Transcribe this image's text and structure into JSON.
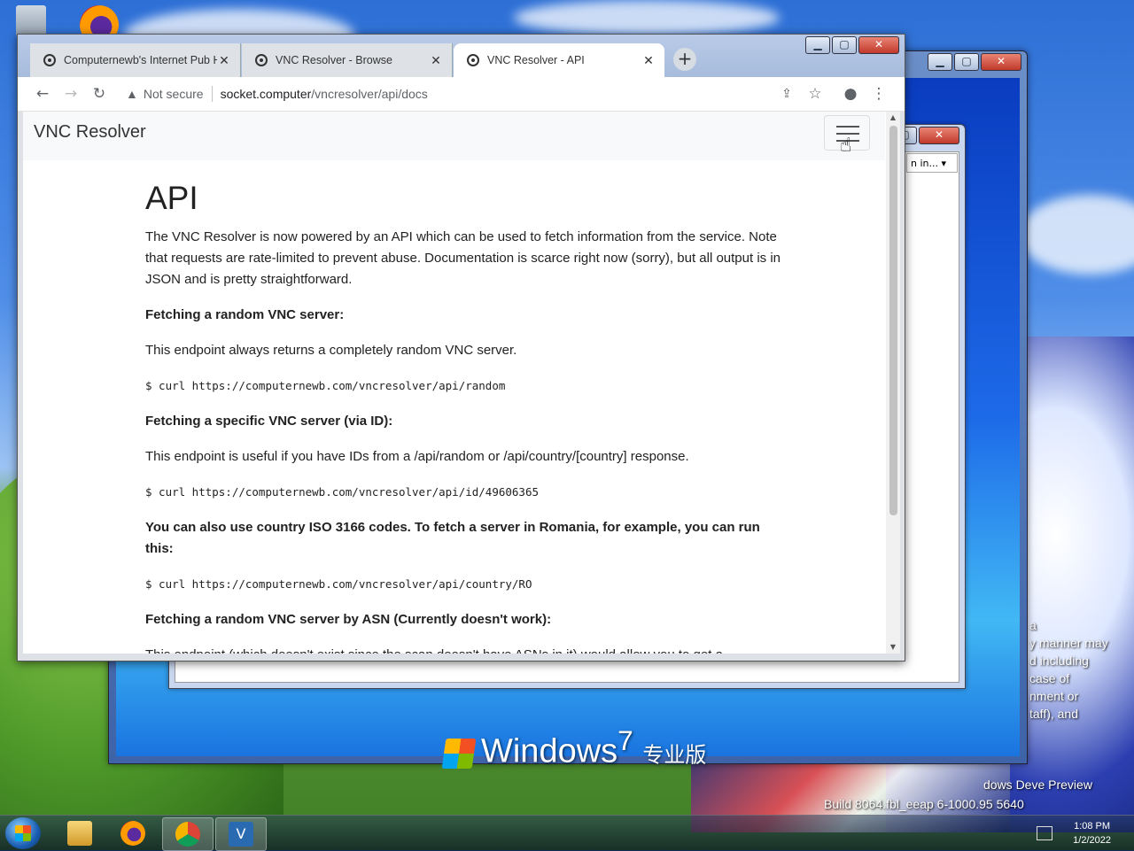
{
  "desktop": {
    "watermark_text": "Windows",
    "watermark_seven": "7",
    "watermark_edition": "专业版",
    "side_text": [
      "a",
      "y manner may",
      "d including",
      "case of",
      "nment or",
      "taff), and"
    ],
    "build_line1": "dows Deve      Preview",
    "build_line2": "Build 8064.fbl_eeap     6-1000.95      5640"
  },
  "dialog": {
    "dropdown_value": "n in..."
  },
  "browser": {
    "tabs": [
      {
        "title": "Computernewb's Internet Pub H",
        "active": false
      },
      {
        "title": "VNC Resolver - Browse",
        "active": false
      },
      {
        "title": "VNC Resolver - API",
        "active": true
      }
    ],
    "new_tab": "+",
    "address": {
      "security_label": "Not secure",
      "host": "socket.computer",
      "path": "/vncresolver/api/docs"
    },
    "caption_buttons": {
      "minimize": "▁",
      "maximize": "▢",
      "close": "✕"
    }
  },
  "page": {
    "brand": "VNC Resolver",
    "heading": "API",
    "intro": "The VNC Resolver is now powered by an API which can be used to fetch information from the service. Note that requests are rate-limited to prevent abuse. Documentation is scarce right now (sorry), but all output is in JSON and is pretty straightforward.",
    "sections": [
      {
        "title": "Fetching a random VNC server:",
        "desc": "This endpoint always returns a completely random VNC server.",
        "code": "$ curl https://computernewb.com/vncresolver/api/random"
      },
      {
        "title": "Fetching a specific VNC server (via ID):",
        "desc": "This endpoint is useful if you have IDs from a /api/random or /api/country/[country] response.",
        "code": "$ curl https://computernewb.com/vncresolver/api/id/49606365"
      },
      {
        "title": "You can also use country ISO 3166 codes. To fetch a server in Romania, for example, you can run this:",
        "code": "$ curl https://computernewb.com/vncresolver/api/country/RO"
      },
      {
        "title": "Fetching a random VNC server by ASN (Currently doesn't work):",
        "desc": "This endpoint (which doesn't exist since the scan doesn't have ASNs in it) would allow you to get a"
      }
    ]
  },
  "taskbar": {
    "clock_time": "1:08 PM",
    "clock_date": "1/2/2022",
    "apps": [
      "explorer-icon",
      "firefox-icon",
      "chrome-icon",
      "vnc-icon"
    ]
  },
  "colors": {
    "accent": "#1a73e8",
    "chrome_frame": "#a7bbdc",
    "text": "#222222"
  }
}
